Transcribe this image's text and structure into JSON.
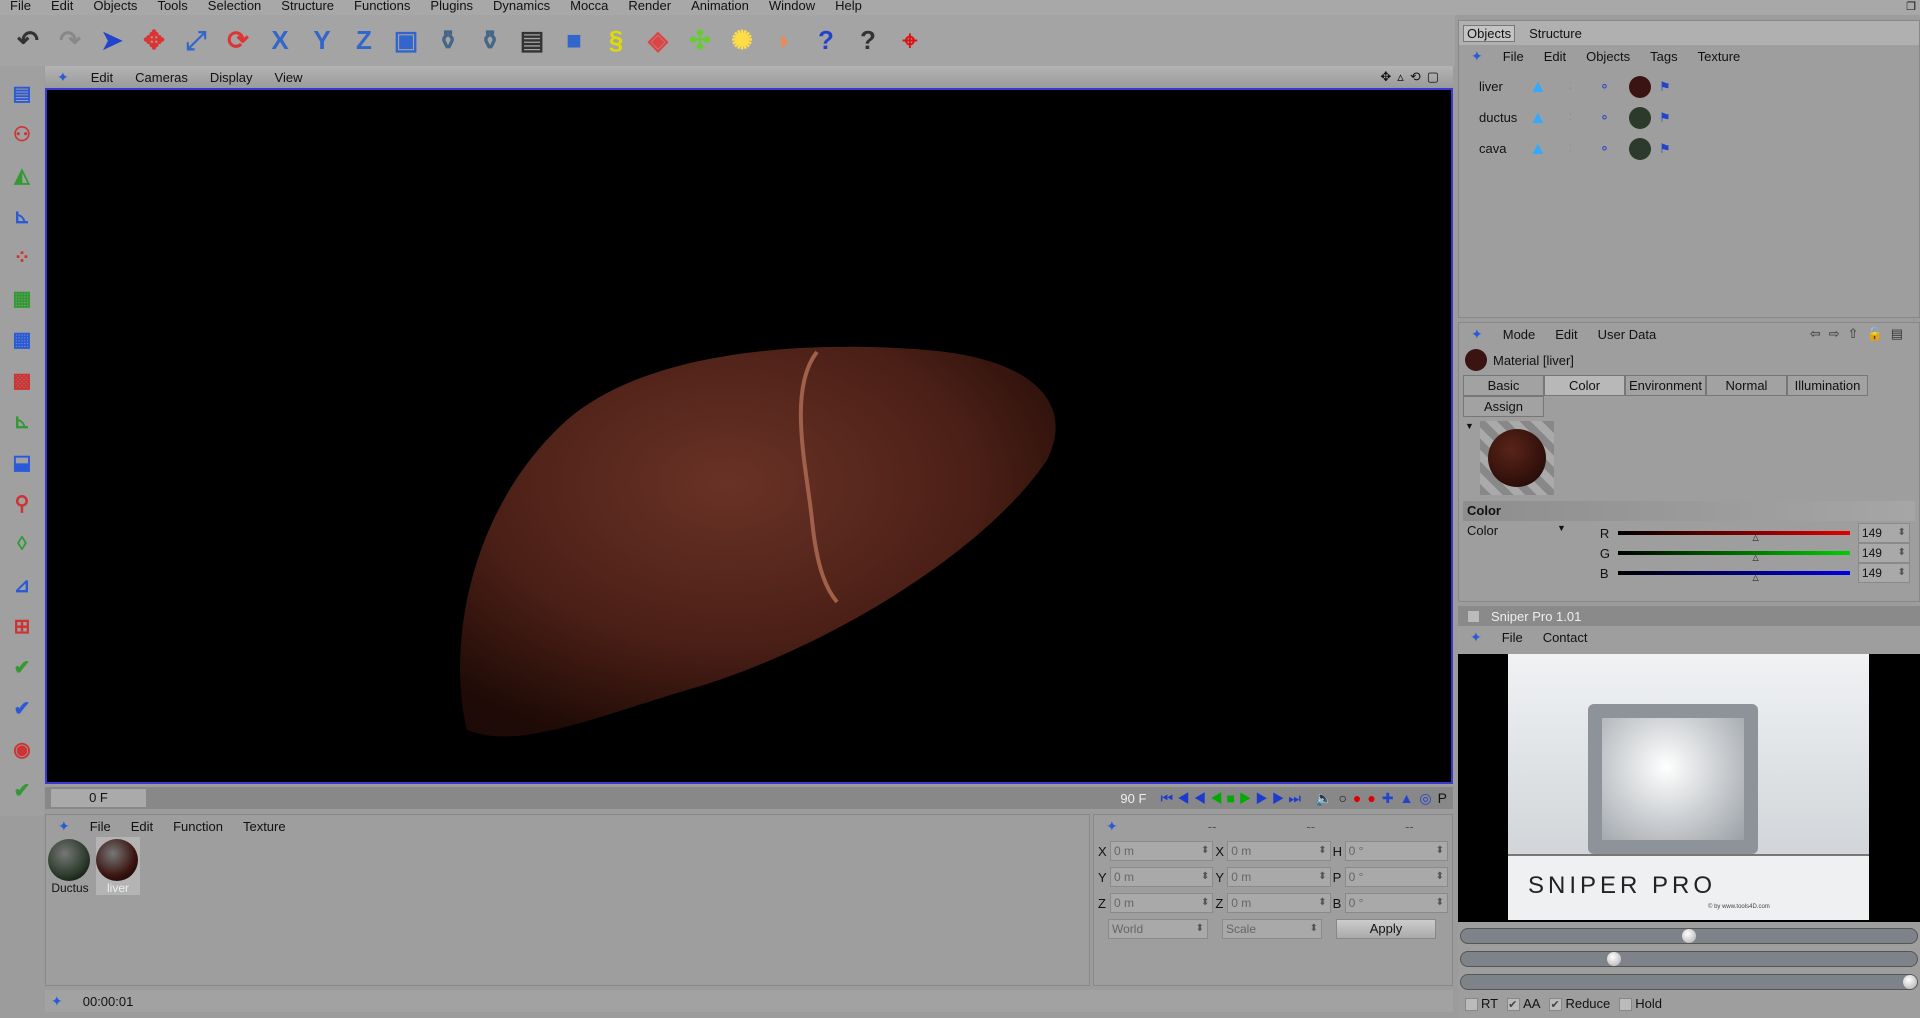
{
  "menu": [
    "File",
    "Edit",
    "Objects",
    "Tools",
    "Selection",
    "Structure",
    "Functions",
    "Plugins",
    "Dynamics",
    "Mocca",
    "Render",
    "Animation",
    "Window",
    "Help"
  ],
  "toolbar_icons": [
    "undo-icon",
    "redo-icon",
    "select-arrow-icon",
    "move-icon",
    "scale-icon",
    "rotate-icon",
    "x-axis-lock-icon",
    "y-axis-lock-icon",
    "z-axis-lock-icon",
    "world-coordinates-icon",
    "render-view-icon",
    "render-picture-viewer-icon",
    "render-settings-icon",
    "cube-primitive-icon",
    "spline-helix-icon",
    "deformer-icon",
    "array-icon",
    "light-icon",
    "camera-icon",
    "help-cursor-icon",
    "help-manual-icon",
    "target-icon"
  ],
  "left_icons": [
    "layout-icon",
    "model-mode-icon",
    "object-axis-icon",
    "axis-icon",
    "points-icon",
    "edges-icon",
    "polygons-icon",
    "texture-icon",
    "texture-axis-icon",
    "animation-icon",
    "inverse-kinematics-icon",
    "bone-icon",
    "spline-tool-icon",
    "weight-icon",
    "paint-check-icon",
    "paint-check-2-icon",
    "sculpt-icon",
    "brush-check-icon"
  ],
  "viewport": {
    "menu": [
      "Edit",
      "Cameras",
      "Display",
      "View"
    ]
  },
  "timeline": {
    "current": "0 F",
    "end": "90 F"
  },
  "materials": {
    "menu": [
      "File",
      "Edit",
      "Function",
      "Texture"
    ],
    "items": [
      {
        "name": "Ductus",
        "color": "#2b3a2a"
      },
      {
        "name": "liver",
        "color": "#3a1410"
      }
    ]
  },
  "coords": {
    "headers": [
      "--",
      "--",
      "--"
    ],
    "rows": [
      [
        "X",
        "0 m",
        "X",
        "0 m",
        "H",
        "0 °"
      ],
      [
        "Y",
        "0 m",
        "Y",
        "0 m",
        "P",
        "0 °"
      ],
      [
        "Z",
        "0 m",
        "Z",
        "0 m",
        "B",
        "0 °"
      ]
    ],
    "space": "World",
    "mode": "Scale",
    "apply": "Apply"
  },
  "status": "00:00:01",
  "objects": {
    "tabs": [
      "Objects",
      "Structure"
    ],
    "menu": [
      "File",
      "Edit",
      "Objects",
      "Tags",
      "Texture"
    ],
    "items": [
      "liver",
      "ductus",
      "cava"
    ]
  },
  "attributes": {
    "menu": [
      "Mode",
      "Edit",
      "User Data"
    ],
    "title": "Material [liver]",
    "tabs": [
      "Basic",
      "Color",
      "Environment",
      "Normal",
      "Illumination",
      "Assign"
    ],
    "section": "Color",
    "param": "Color",
    "channels": [
      {
        "label": "R",
        "value": "149",
        "color": "#e00000"
      },
      {
        "label": "G",
        "value": "149",
        "color": "#00d000"
      },
      {
        "label": "B",
        "value": "149",
        "color": "#0000e0"
      }
    ],
    "channel_fraction": 0.58
  },
  "sniper": {
    "title": "Sniper Pro 1.01",
    "menu": [
      "File",
      "Contact"
    ],
    "logo": "SNIPER PRO",
    "credit": "© by www.tools4D.com",
    "sliders": [
      0.5,
      0.33,
      1.0
    ],
    "options": [
      {
        "label": "RT",
        "checked": false
      },
      {
        "label": "AA",
        "checked": true
      },
      {
        "label": "Reduce",
        "checked": true
      },
      {
        "label": "Hold",
        "checked": false
      }
    ]
  }
}
